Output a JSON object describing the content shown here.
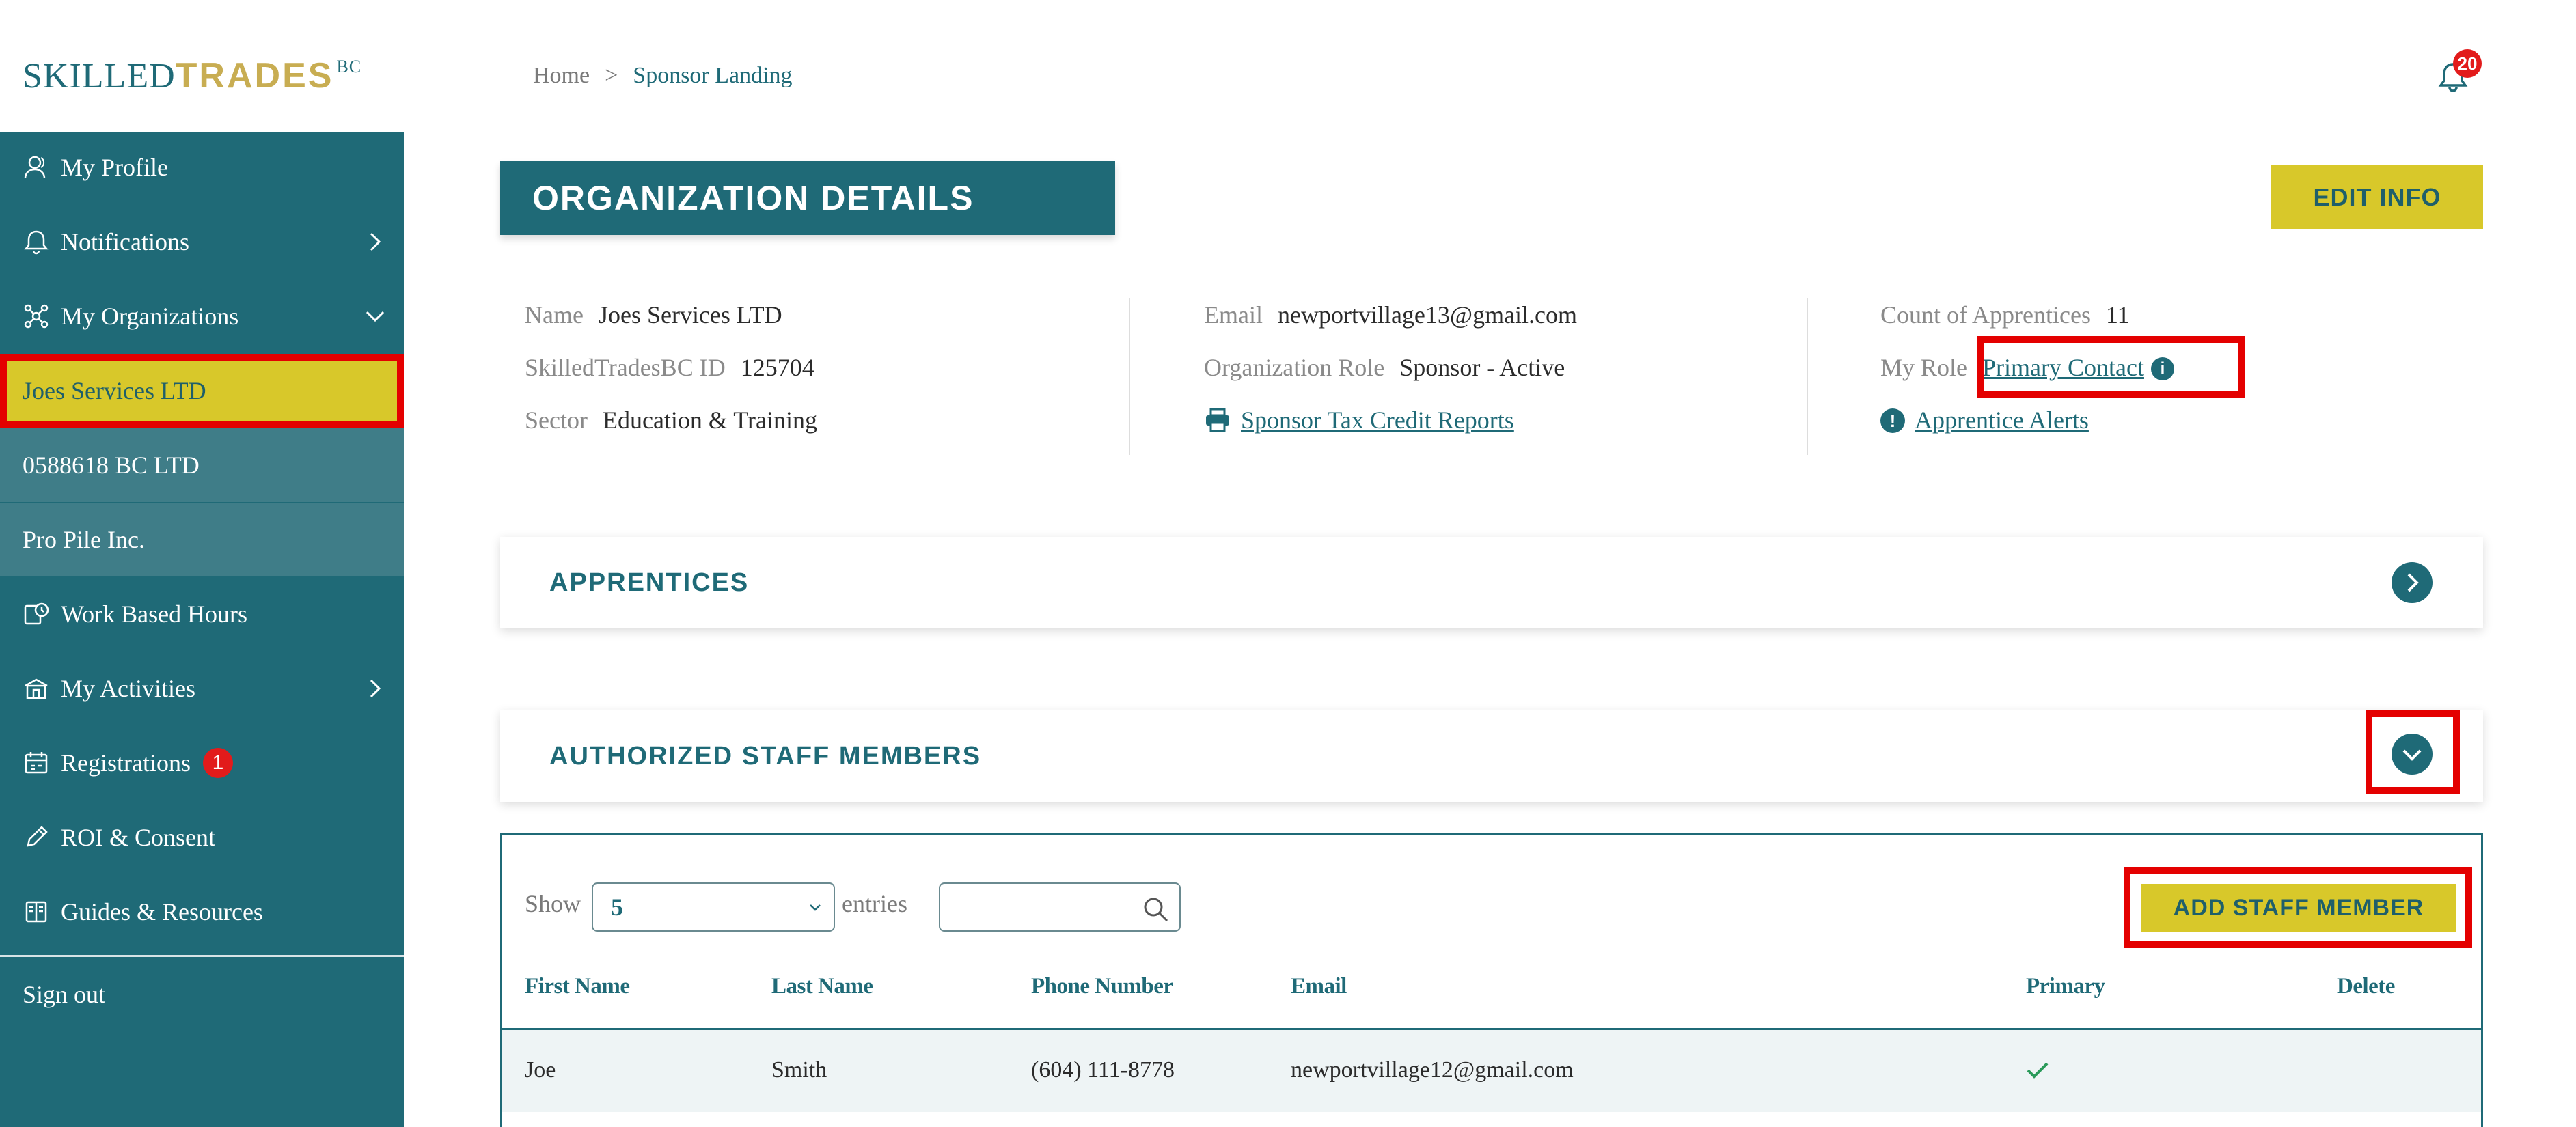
{
  "logo": {
    "part1": "SKILLED",
    "part2": "TRADES",
    "part3": "BC"
  },
  "sidebar": {
    "items": [
      {
        "label": "My Profile",
        "icon": "user-icon"
      },
      {
        "label": "Notifications",
        "icon": "bell-icon"
      },
      {
        "label": "My Organizations",
        "icon": "network-icon"
      },
      {
        "label": "Work Based Hours",
        "icon": "clock-icon"
      },
      {
        "label": "My Activities",
        "icon": "school-icon"
      },
      {
        "label": "Registrations",
        "icon": "calendar-icon",
        "badge": "1"
      },
      {
        "label": "ROI & Consent",
        "icon": "pencil-icon"
      },
      {
        "label": "Guides & Resources",
        "icon": "book-icon"
      }
    ],
    "organizations": [
      "Joes Services LTD",
      "0588618 BC LTD",
      "Pro Pile Inc."
    ],
    "sign_out": "Sign out"
  },
  "breadcrumb": {
    "home": "Home",
    "separator": ">",
    "current": "Sponsor Landing"
  },
  "notifications": {
    "count": "20"
  },
  "page_title": "ORGANIZATION DETAILS",
  "edit_info_label": "EDIT INFO",
  "details": {
    "name": {
      "label": "Name",
      "value": "Joes Services LTD"
    },
    "id": {
      "label": "SkilledTradesBC ID",
      "value": "125704"
    },
    "sector": {
      "label": "Sector",
      "value": "Education & Training"
    },
    "email": {
      "label": "Email",
      "value": "newportvillage13@gmail.com"
    },
    "role": {
      "label": "Organization Role",
      "value": "Sponsor - Active"
    },
    "tax_link": "Sponsor Tax Credit Reports",
    "count": {
      "label": "Count of Apprentices",
      "value": "11"
    },
    "my_role": {
      "label": "My Role",
      "value": "Primary Contact"
    },
    "alerts_link": "Apprentice Alerts"
  },
  "accordions": {
    "apprentices": "APPRENTICES",
    "staff": "AUTHORIZED STAFF MEMBERS"
  },
  "table": {
    "show_label": "Show",
    "entries_value": "5",
    "entries_label": "entries",
    "search_placeholder": "",
    "add_label": "ADD STAFF MEMBER",
    "headers": {
      "first": "First Name",
      "last": "Last Name",
      "phone": "Phone Number",
      "email": "Email",
      "primary": "Primary",
      "delete": "Delete"
    },
    "rows": [
      {
        "first": "Joe",
        "last": "Smith",
        "phone": "(604) 111-8778",
        "email": "newportvillage12@gmail.com",
        "primary": true
      }
    ]
  },
  "colors": {
    "teal": "#1f6a77",
    "yellow": "#d8c82a",
    "gold": "#c8ad52",
    "highlight": "#e40000"
  }
}
